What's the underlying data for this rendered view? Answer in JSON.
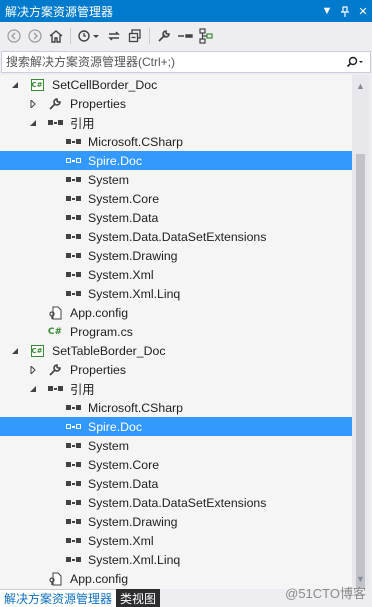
{
  "window": {
    "title": "解决方案资源管理器"
  },
  "search": {
    "placeholder": "搜索解决方案资源管理器(Ctrl+;)"
  },
  "tree": {
    "project1": {
      "name": "SetCellBorder_Doc",
      "properties": "Properties",
      "references": "引用",
      "refs": [
        "Microsoft.CSharp",
        "Spire.Doc",
        "System",
        "System.Core",
        "System.Data",
        "System.Data.DataSetExtensions",
        "System.Drawing",
        "System.Xml",
        "System.Xml.Linq"
      ],
      "app_config": "App.config",
      "program": "Program.cs"
    },
    "project2": {
      "name": "SetTableBorder_Doc",
      "properties": "Properties",
      "references": "引用",
      "refs": [
        "Microsoft.CSharp",
        "Spire.Doc",
        "System",
        "System.Core",
        "System.Data",
        "System.Data.DataSetExtensions",
        "System.Drawing",
        "System.Xml",
        "System.Xml.Linq"
      ],
      "app_config": "App.config"
    }
  },
  "tabs": {
    "solution_explorer": "解决方案资源管理器",
    "class_view": "类视图"
  },
  "watermark": "@51CTO博客",
  "colors": {
    "title_bar": "#007acc",
    "selection": "#3399ff",
    "csharp_green": "#388a34"
  }
}
